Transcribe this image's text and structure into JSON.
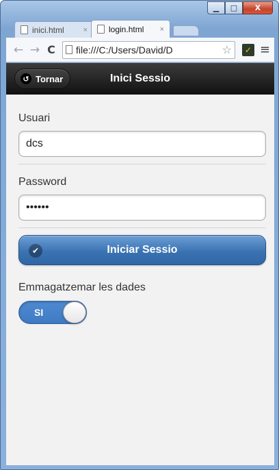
{
  "browser": {
    "tabs": [
      {
        "label": "inici.html",
        "close": "×"
      },
      {
        "label": "login.html",
        "close": "×"
      }
    ],
    "window_controls": {
      "minimize": "▁",
      "maximize": "□",
      "close": "X"
    },
    "nav": {
      "back": "←",
      "forward": "→",
      "reload": "C"
    },
    "address": "file:///C:/Users/David/D",
    "bookmark_star": "☆",
    "extension_glyph": "✓",
    "menu_glyph": "≡"
  },
  "header": {
    "back_icon": "↺",
    "back_label": "Tornar",
    "title": "Inici Sessio"
  },
  "form": {
    "user_label": "Usuari",
    "user_value": "dcs",
    "password_label": "Password",
    "password_value": "••••••",
    "login_icon": "✔",
    "login_label": "Iniciar Sessio",
    "store_label": "Emmagatzemar les dades",
    "store_toggle_label": "SI",
    "store_toggle_on": true
  },
  "colors": {
    "accent": "#3b73b2",
    "header_bg": "#1a1a1a",
    "page_bg": "#f2f2f2"
  }
}
